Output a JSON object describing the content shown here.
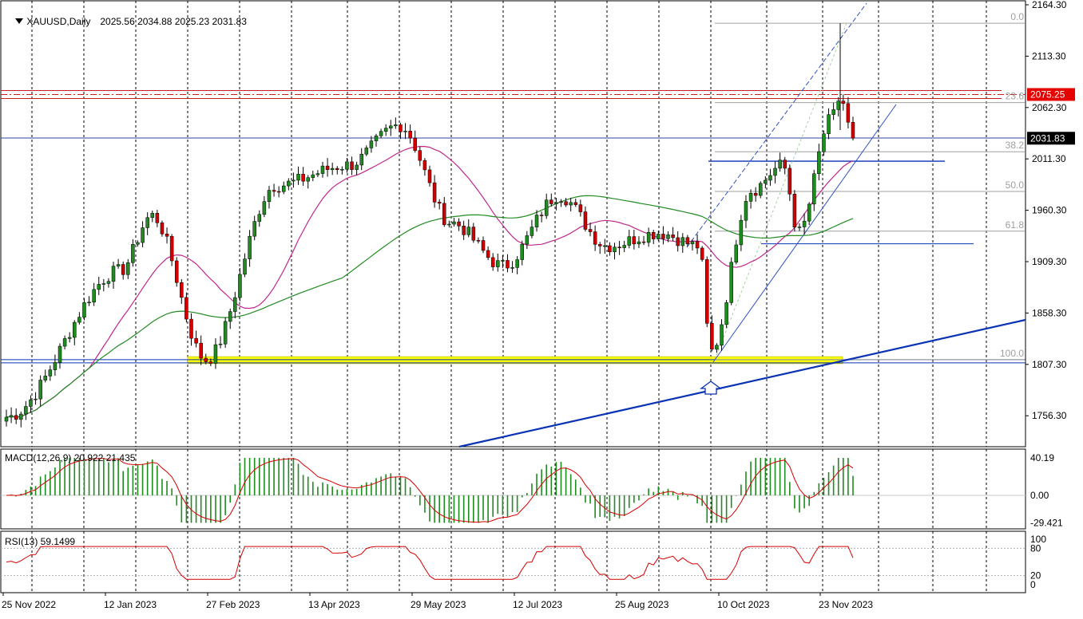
{
  "header": {
    "symbol": "XAUUSD,Daily",
    "ohlc": "2025.56 2034.88 2025.23 2031.83"
  },
  "indicators": {
    "macd_label": "MACD(12,26,9) 20.922 21.435",
    "rsi_label": "RSI(13) 59.1499"
  },
  "price_axis": {
    "ticks": [
      "2164.30",
      "2113.30",
      "2062.30",
      "2011.30",
      "1960.30",
      "1909.30",
      "1858.30",
      "1807.30",
      "1756.30"
    ],
    "tick_values": [
      2164.3,
      2113.3,
      2062.3,
      2011.3,
      1960.3,
      1909.3,
      1858.3,
      1807.3,
      1756.3
    ],
    "red_label": "2075.25",
    "current_label": "2031.83"
  },
  "macd_axis": {
    "ticks": [
      "40.19",
      "0.00",
      "-29.421"
    ]
  },
  "rsi_axis": {
    "ticks": [
      "100",
      "80",
      "20",
      "0"
    ]
  },
  "time_axis": {
    "labels": [
      "25 Nov 2022",
      "12 Jan 2023",
      "27 Feb 2023",
      "13 Apr 2023",
      "29 May 2023",
      "12 Jul 2023",
      "25 Aug 2023",
      "10 Oct 2023",
      "23 Nov 2023"
    ]
  },
  "fibonacci": {
    "levels": [
      "0.0",
      "23.6",
      "38.2",
      "50.0",
      "61.8",
      "100.0"
    ],
    "level_values": [
      0,
      23.6,
      38.2,
      50,
      61.8,
      100
    ],
    "high": 2146,
    "low": 1812
  },
  "colors": {
    "bull": "#1e8c1e",
    "bear": "#d40000",
    "ma_fast": "#c0288c",
    "ma_slow": "#228b22",
    "trend": "#0a32b4",
    "resistance": "#c81e1e",
    "support_zone": "#ffff00"
  },
  "chart_data": {
    "type": "candlestick",
    "symbol": "XAUUSD",
    "timeframe": "Daily",
    "x_labels": [
      "25 Nov 2022",
      "12 Jan 2023",
      "27 Feb 2023",
      "13 Apr 2023",
      "29 May 2023",
      "12 Jul 2023",
      "25 Aug 2023",
      "10 Oct 2023",
      "23 Nov 2023"
    ],
    "price_range": [
      1735,
      2170
    ],
    "key_points": [
      {
        "x": "25 Nov 2022",
        "close": 1755
      },
      {
        "x": "12 Jan 2023",
        "close": 1900
      },
      {
        "x": "02 Feb 2023",
        "close": 1955
      },
      {
        "x": "27 Feb 2023",
        "close": 1812
      },
      {
        "x": "20 Mar 2023",
        "close": 1985
      },
      {
        "x": "13 Apr 2023",
        "close": 2005
      },
      {
        "x": "04 May 2023",
        "close": 2045
      },
      {
        "x": "29 May 2023",
        "close": 1948
      },
      {
        "x": "29 Jun 2023",
        "close": 1905
      },
      {
        "x": "20 Jul 2023",
        "close": 1975
      },
      {
        "x": "08 Aug 2023",
        "close": 1925
      },
      {
        "x": "25 Aug 2023",
        "close": 1938
      },
      {
        "x": "15 Sep 2023",
        "close": 1925
      },
      {
        "x": "05 Oct 2023",
        "close": 1820
      },
      {
        "x": "20 Oct 2023",
        "close": 1980
      },
      {
        "x": "27 Oct 2023",
        "close": 2005
      },
      {
        "x": "13 Nov 2023",
        "close": 1938
      },
      {
        "x": "01 Dec 2023",
        "close": 2050
      },
      {
        "x": "04 Dec 2023",
        "close": 2072
      },
      {
        "x": "08 Dec 2023",
        "close": 2031.83
      }
    ],
    "levels": {
      "resistance": 2075.25,
      "current": 2031.83,
      "support_zone": [
        1808,
        1815
      ],
      "blue_horizontal": [
        2032,
        2009,
        1927,
        1812
      ]
    },
    "macd": {
      "params": "12,26,9",
      "macd": 20.922,
      "signal": 21.435,
      "range": [
        -29.421,
        40.19
      ]
    },
    "rsi": {
      "period": 13,
      "value": 59.1499,
      "levels": [
        80,
        20
      ]
    }
  }
}
